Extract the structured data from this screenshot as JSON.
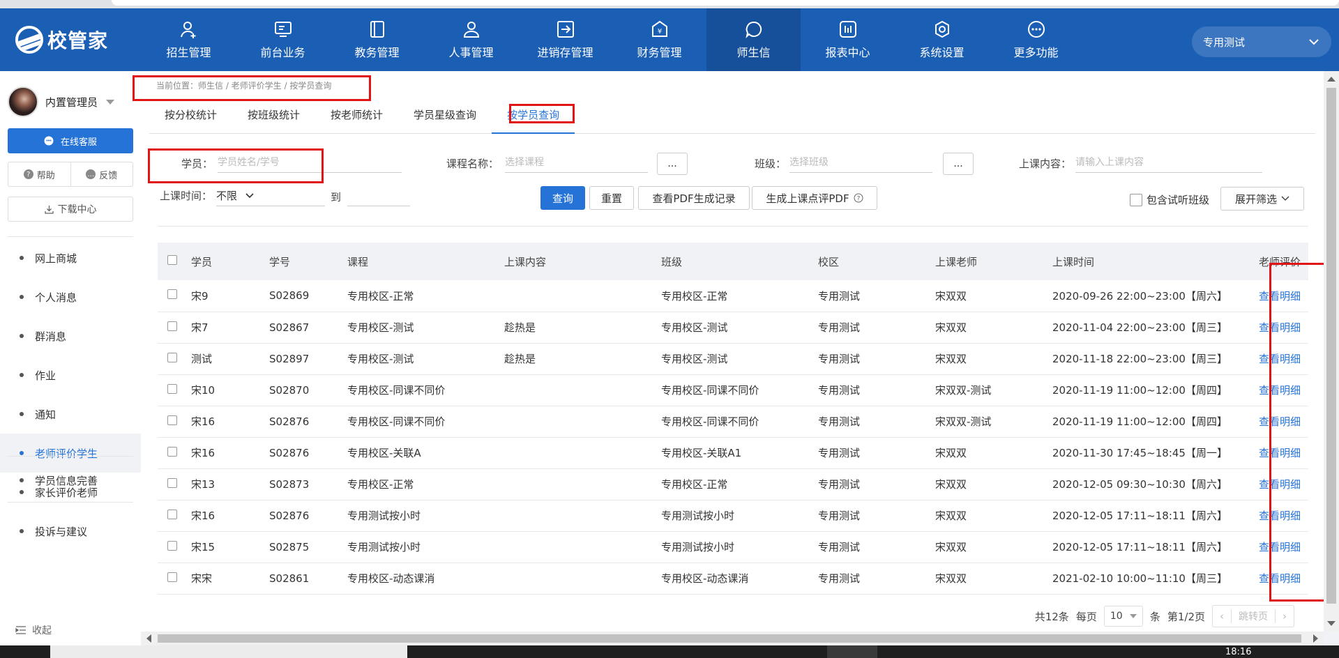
{
  "brand": {
    "name": "校管家"
  },
  "topnav": {
    "items": [
      {
        "label": "招生管理",
        "icon": "user-add-icon"
      },
      {
        "label": "前台业务",
        "icon": "monitor-icon"
      },
      {
        "label": "教务管理",
        "icon": "book-icon"
      },
      {
        "label": "人事管理",
        "icon": "person-icon"
      },
      {
        "label": "进销存管理",
        "icon": "box-arrow-icon"
      },
      {
        "label": "财务管理",
        "icon": "yen-shield-icon"
      },
      {
        "label": "师生信",
        "icon": "chat-circle-icon",
        "active": true
      },
      {
        "label": "报表中心",
        "icon": "bar-report-icon"
      },
      {
        "label": "系统设置",
        "icon": "gear-icon"
      },
      {
        "label": "更多功能",
        "icon": "more-dots-icon"
      }
    ],
    "campus": "专用测试"
  },
  "sidebar": {
    "user_name": "内置管理员",
    "customer_service": "在线客服",
    "help": "帮助",
    "feedback": "反馈",
    "download_center": "下载中心",
    "menu": [
      {
        "label": "网上商城"
      },
      {
        "label": "个人消息"
      },
      {
        "label": "群消息"
      },
      {
        "label": "作业"
      },
      {
        "label": "通知"
      },
      {
        "label": "老师评价学生",
        "active": true
      },
      {
        "label": "家长评价老师"
      },
      {
        "label": "投诉与建议"
      }
    ],
    "menu_bottom": "学员信息完善",
    "collapse": "收起"
  },
  "breadcrumb": "当前位置：师生信 / 老师评价学生 / 按学员查询",
  "tabs": [
    {
      "label": "按分校统计"
    },
    {
      "label": "按班级统计"
    },
    {
      "label": "按老师统计"
    },
    {
      "label": "学员星级查询"
    },
    {
      "label": "按学员查询",
      "active": true
    }
  ],
  "filters": {
    "student_label": "学员：",
    "student_placeholder": "学员姓名/学号",
    "course_label": "课程名称：",
    "course_placeholder": "选择课程",
    "class_label": "班级：",
    "class_placeholder": "选择班级",
    "content_label": "上课内容：",
    "content_placeholder": "请输入上课内容",
    "ellipsis": "...",
    "time_label": "上课时间：",
    "time_value": "不限",
    "to_label": "到",
    "include_trial": "包含试听班级",
    "expand_filter": "展开筛选"
  },
  "buttons": {
    "query": "查询",
    "reset": "重置",
    "pdf_records": "查看PDF生成记录",
    "gen_pdf": "生成上课点评PDF"
  },
  "table": {
    "headers": [
      "学员",
      "学号",
      "课程",
      "上课内容",
      "班级",
      "校区",
      "上课老师",
      "上课时间",
      "老师评价"
    ],
    "rows": [
      [
        "宋9",
        "S02869",
        "专用校区-正常",
        "",
        "专用校区-正常",
        "专用测试",
        "宋双双",
        "2020-09-26 22:00~23:00【周六】",
        "查看明细"
      ],
      [
        "宋7",
        "S02867",
        "专用校区-测试",
        "趁热是",
        "专用校区-测试",
        "专用测试",
        "宋双双",
        "2020-11-04 22:00~23:00【周三】",
        "查看明细"
      ],
      [
        "测试",
        "S02897",
        "专用校区-测试",
        "趁热是",
        "专用校区-测试",
        "专用测试",
        "宋双双",
        "2020-11-18 22:00~23:00【周三】",
        "查看明细"
      ],
      [
        "宋10",
        "S02870",
        "专用校区-同课不同价",
        "",
        "专用校区-同课不同价",
        "专用测试",
        "宋双双-测试",
        "2020-11-19 11:00~12:00【周四】",
        "查看明细"
      ],
      [
        "宋16",
        "S02876",
        "专用校区-同课不同价",
        "",
        "专用校区-同课不同价",
        "专用测试",
        "宋双双-测试",
        "2020-11-19 11:00~12:00【周四】",
        "查看明细"
      ],
      [
        "宋16",
        "S02876",
        "专用校区-关联A",
        "",
        "专用校区-关联A1",
        "专用测试",
        "宋双双",
        "2020-11-30 17:45~18:45【周一】",
        "查看明细"
      ],
      [
        "宋13",
        "S02873",
        "专用校区-正常",
        "",
        "专用校区-正常",
        "专用测试",
        "宋双双",
        "2020-12-05 09:30~10:30【周六】",
        "查看明细"
      ],
      [
        "宋16",
        "S02876",
        "专用测试按小时",
        "",
        "专用测试按小时",
        "专用测试",
        "宋双双",
        "2020-12-05 17:11~18:11【周六】",
        "查看明细"
      ],
      [
        "宋15",
        "S02875",
        "专用测试按小时",
        "",
        "专用测试按小时",
        "专用测试",
        "宋双双",
        "2020-12-05 17:11~18:11【周六】",
        "查看明细"
      ],
      [
        "宋宋",
        "S02861",
        "专用校区-动态课消",
        "",
        "专用校区-动态课消",
        "专用测试",
        "宋双双",
        "2021-02-10 10:00~11:10【周三】",
        "查看明细"
      ]
    ]
  },
  "pagination": {
    "total": "共12条",
    "per_page_label": "每页",
    "per_page": "10",
    "unit": "条",
    "page_info": "第1/2页",
    "jump": "跳转页"
  },
  "taskbar": {
    "time": "18:16"
  },
  "colors": {
    "nav_bg": "#1b5fb5",
    "accent": "#2673d8",
    "highlight": "#e01414"
  }
}
